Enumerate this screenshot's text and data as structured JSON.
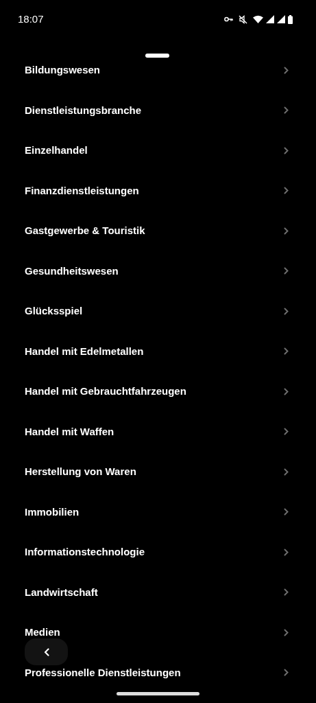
{
  "status_bar": {
    "time": "18:07"
  },
  "items": [
    {
      "label": "Bildungswesen"
    },
    {
      "label": "Dienstleistungsbranche"
    },
    {
      "label": "Einzelhandel"
    },
    {
      "label": "Finanzdienstleistungen"
    },
    {
      "label": "Gastgewerbe & Touristik"
    },
    {
      "label": "Gesundheitswesen"
    },
    {
      "label": "Glücksspiel"
    },
    {
      "label": "Handel mit Edelmetallen"
    },
    {
      "label": "Handel mit Gebrauchtfahrzeugen"
    },
    {
      "label": "Handel mit Waffen"
    },
    {
      "label": "Herstellung von Waren"
    },
    {
      "label": "Immobilien"
    },
    {
      "label": "Informationstechnologie"
    },
    {
      "label": "Landwirtschaft"
    },
    {
      "label": "Medien"
    },
    {
      "label": "Professionelle Dienstleistungen"
    }
  ]
}
